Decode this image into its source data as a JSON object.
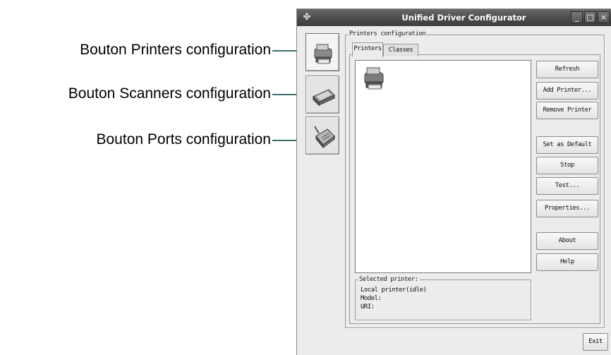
{
  "callouts": [
    {
      "text": "Bouton Printers configuration"
    },
    {
      "text": "Bouton Scanners configuration"
    },
    {
      "text": "Bouton Ports configuration"
    }
  ],
  "window": {
    "title": "Unified Driver Configurator",
    "controls": [
      "_",
      "□",
      "×"
    ]
  },
  "nav": [
    {
      "name": "printers",
      "icon": "printer-icon",
      "active": true
    },
    {
      "name": "scanners",
      "icon": "scanner-icon",
      "active": false
    },
    {
      "name": "ports",
      "icon": "port-icon",
      "active": false
    }
  ],
  "printers_group": {
    "label": "Printers configuration",
    "tabs": [
      "Printers",
      "Classes"
    ],
    "active_tab": "Printers",
    "list_items": [
      {
        "icon": "printer-icon",
        "label": ""
      }
    ],
    "buttons": [
      "Refresh",
      "Add Printer...",
      "Remove Printer",
      "Set as Default",
      "Stop",
      "Test...",
      "Properties...",
      "About",
      "Help"
    ]
  },
  "selected_printer": {
    "label": "Selected printer:",
    "lines": [
      "Local printer(idle)",
      "Model:",
      "URI:"
    ]
  },
  "footer": {
    "exit_label": "Exit"
  },
  "colors": {
    "titlebar": "#4a4a4a",
    "leader": "#3a6e6a",
    "window_bg": "#ececec"
  }
}
